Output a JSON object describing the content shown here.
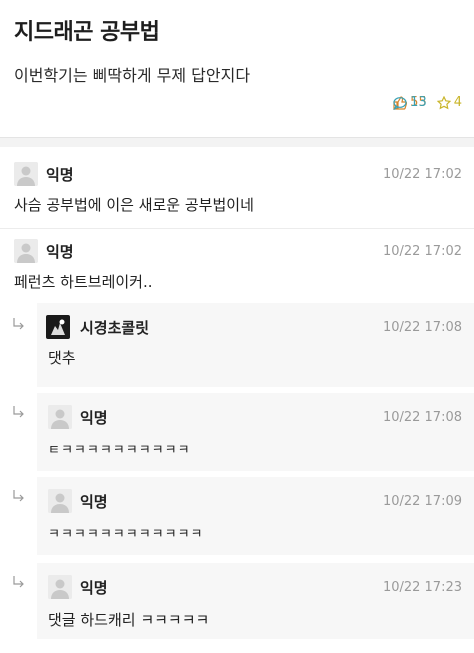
{
  "post": {
    "title": "지드래곤 공부법",
    "body": "이번학기는 삐딱하게 무제 답안지다",
    "likes": "55",
    "comments": "13",
    "scraps": "4",
    "colors": {
      "like": "#d4862f",
      "comment": "#3aa1b3",
      "scrap": "#c9b52a"
    }
  },
  "comments": [
    {
      "nick": "익명",
      "time": "10/22 17:02",
      "text": "사슴 공부법에 이은 새로운 공부법이네",
      "reply": false,
      "avatar": "default-avatar-icon"
    },
    {
      "nick": "익명",
      "time": "10/22 17:02",
      "text": "페런츠 하트브레이커..",
      "reply": false,
      "avatar": "default-avatar-icon"
    },
    {
      "nick": "시경초콜릿",
      "time": "10/22 17:08",
      "text": "댓추",
      "reply": true,
      "avatar": "custom-avatar-icon"
    },
    {
      "nick": "익명",
      "time": "10/22 17:08",
      "text": "ㅌㅋㅋㅋㅋㅋㅋㅋㅋㅋㅋ",
      "reply": true,
      "avatar": "default-avatar-icon"
    },
    {
      "nick": "익명",
      "time": "10/22 17:09",
      "text": "ㅋㅋㅋㅋㅋㅋㅋㅋㅋㅋㅋㅋ",
      "reply": true,
      "avatar": "default-avatar-icon"
    },
    {
      "nick": "익명",
      "time": "10/22 17:23",
      "text": "댓글 하드캐리 ㅋㅋㅋㅋㅋ",
      "reply": true,
      "avatar": "default-avatar-icon"
    }
  ]
}
